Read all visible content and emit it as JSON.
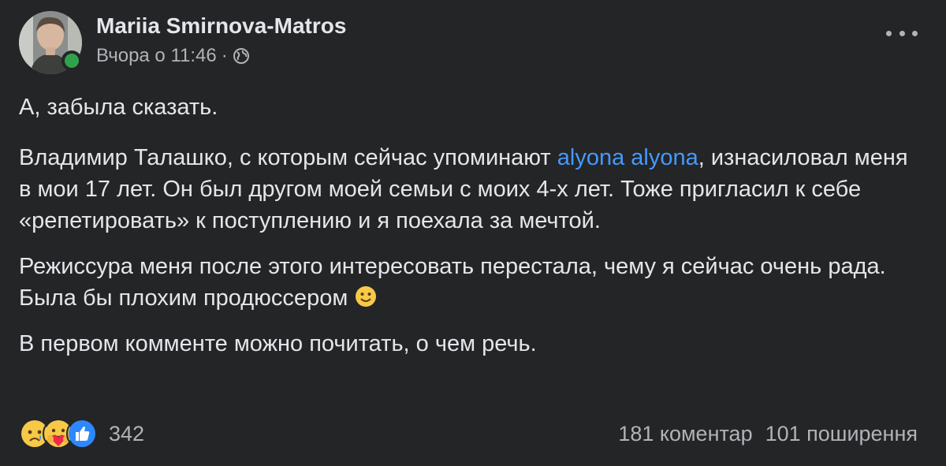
{
  "author": {
    "name": "Mariia Smirnova-Matros",
    "timestamp": "Вчора о 11:46",
    "separator": "·",
    "privacy_icon": "globe-icon"
  },
  "post": {
    "paragraph1": "А, забыла сказать.",
    "paragraph2_before": "Владимир Талашко, с которым сейчас упоминают ",
    "paragraph2_mention": "alyona alyona",
    "paragraph2_after": ", изнасиловал меня в мои 17 лет. Он был другом моей семьи с моих 4-х лет. Тоже пригласил к себе «репетировать» к поступлению и я поехала за мечтой.",
    "paragraph3": "Режиссура меня после этого интересовать перестала, чему я сейчас очень рада. Была бы плохим продюссером ",
    "paragraph3_emoji": "smile-emoji-icon",
    "paragraph4": "В первом комменте можно почитать, о чем речь."
  },
  "footer": {
    "reactions": [
      "sad-reaction-icon",
      "care-reaction-icon",
      "like-reaction-icon"
    ],
    "reaction_count": "342",
    "comments": "181 коментар",
    "shares": "101 поширення"
  },
  "colors": {
    "background": "#242526",
    "text": "#e4e6eb",
    "secondary": "#b0b3b8",
    "link": "#4599ff",
    "online": "#31a24c"
  }
}
